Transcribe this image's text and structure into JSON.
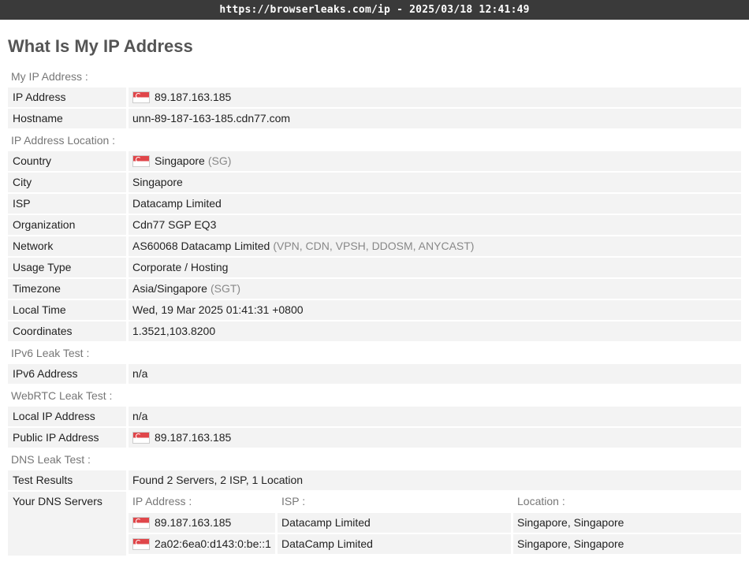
{
  "url_bar": "https://browserleaks.com/ip - 2025/03/18 12:41:49",
  "page_title": "What Is My IP Address",
  "sections": {
    "my_ip": {
      "title": "My IP Address :",
      "ip_label": "IP Address",
      "ip_value": "89.187.163.185",
      "hostname_label": "Hostname",
      "hostname_value": "unn-89-187-163-185.cdn77.com"
    },
    "location": {
      "title": "IP Address Location :",
      "country_label": "Country",
      "country_value": "Singapore",
      "country_code": "(SG)",
      "city_label": "City",
      "city_value": "Singapore",
      "isp_label": "ISP",
      "isp_value": "Datacamp Limited",
      "org_label": "Organization",
      "org_value": "Cdn77 SGP EQ3",
      "network_label": "Network",
      "network_value": "AS60068 Datacamp Limited",
      "network_tags": "(VPN, CDN, VPSH, DDOSM, ANYCAST)",
      "usage_label": "Usage Type",
      "usage_value": "Corporate / Hosting",
      "tz_label": "Timezone",
      "tz_value": "Asia/Singapore",
      "tz_abbr": "(SGT)",
      "localtime_label": "Local Time",
      "localtime_value": "Wed, 19 Mar 2025 01:41:31 +0800",
      "coords_label": "Coordinates",
      "coords_value": "1.3521,103.8200"
    },
    "ipv6": {
      "title": "IPv6 Leak Test :",
      "addr_label": "IPv6 Address",
      "addr_value": "n/a"
    },
    "webrtc": {
      "title": "WebRTC Leak Test :",
      "local_label": "Local IP Address",
      "local_value": "n/a",
      "public_label": "Public IP Address",
      "public_value": "89.187.163.185"
    },
    "dns": {
      "title": "DNS Leak Test :",
      "results_label": "Test Results",
      "results_value": "Found 2 Servers, 2 ISP, 1 Location",
      "servers_label": "Your DNS Servers",
      "headers": {
        "ip": "IP Address :",
        "isp": "ISP :",
        "location": "Location :"
      },
      "servers": [
        {
          "ip": "89.187.163.185",
          "isp": "Datacamp Limited",
          "location": "Singapore, Singapore"
        },
        {
          "ip": "2a02:6ea0:d143:0:be::1",
          "isp": "DataCamp Limited",
          "location": "Singapore, Singapore"
        }
      ]
    }
  },
  "icons": {
    "flag": "singapore-flag-icon"
  },
  "colors": {
    "topbar": "#3a3a3a",
    "row_bg": "#f3f3f3",
    "muted": "#888888",
    "flag_red": "#e0464a"
  }
}
